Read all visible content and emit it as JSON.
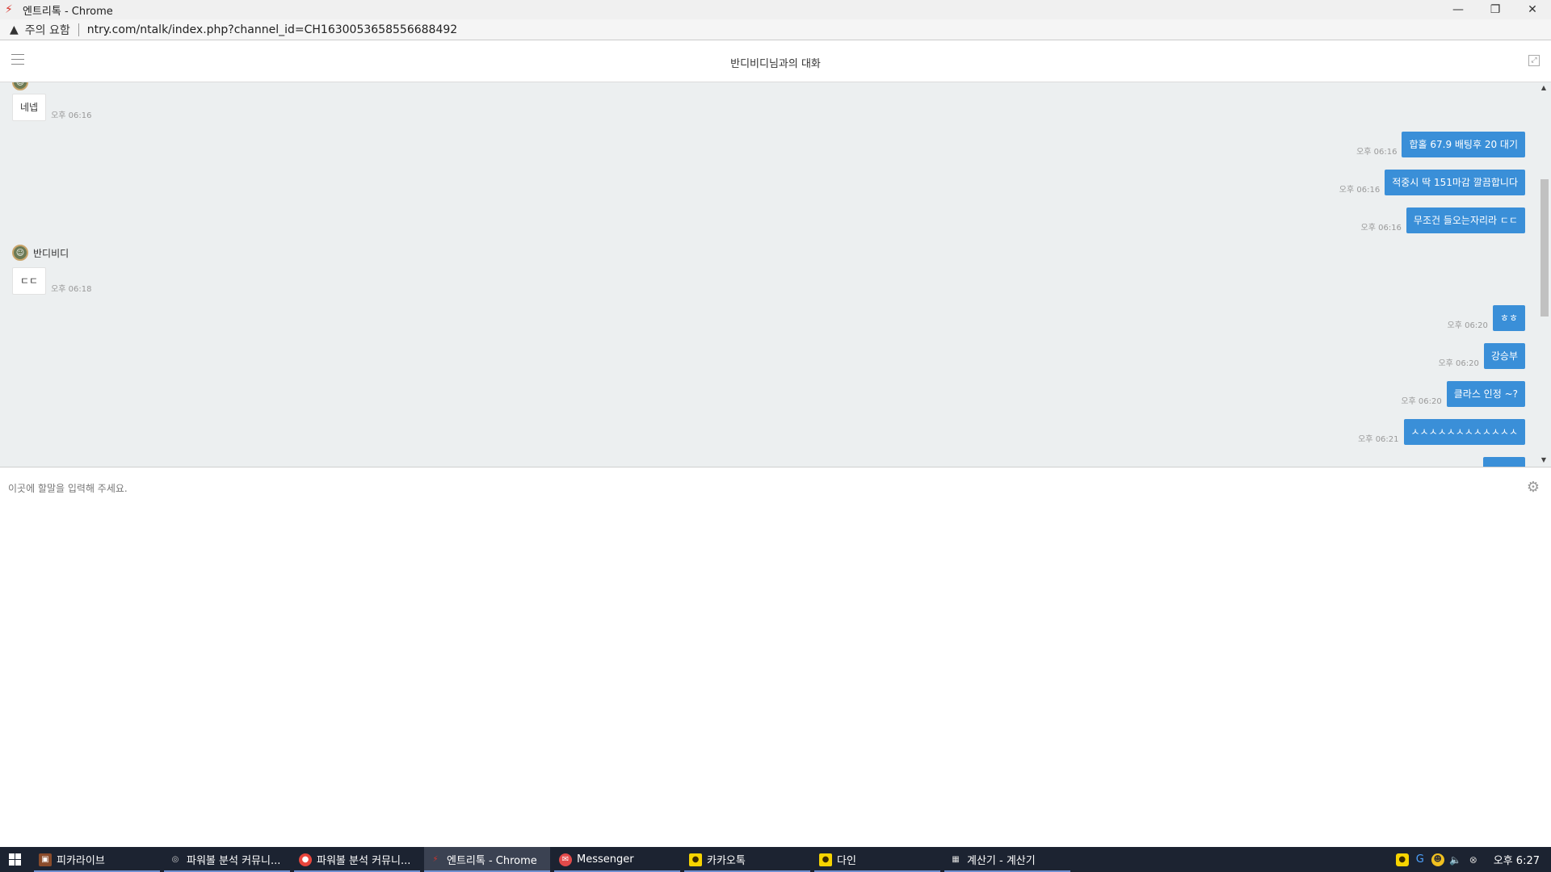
{
  "window": {
    "title": "엔트리톡 - Chrome",
    "minimize": "—",
    "restore": "❐",
    "close": "✕"
  },
  "address": {
    "warning": "주의 요함",
    "url": "ntry.com/ntalk/index.php?channel_id=CH1630053658556688492"
  },
  "chat": {
    "title": "반디비디님과의 대화",
    "input_placeholder": "이곳에 할말을 입력해 주세요.",
    "messages": [
      {
        "dir": "in",
        "text": "네넵",
        "time": "오후 06:16"
      },
      {
        "dir": "out",
        "text": "합홀 67.9 배팅후 20 대기",
        "time": "오후 06:16"
      },
      {
        "dir": "out",
        "text": "적중시 딱 151마감 깔끔합니다",
        "time": "오후 06:16"
      },
      {
        "dir": "out",
        "text": "무조건 들오는자리라 ㄷㄷ",
        "time": "오후 06:16"
      },
      {
        "dir": "in",
        "sender": "반디비디",
        "text": "ㄷㄷ",
        "time": "오후 06:18"
      },
      {
        "dir": "out",
        "text": "ㅎㅎ",
        "time": "오후 06:20"
      },
      {
        "dir": "out",
        "text": "강승부",
        "time": "오후 06:20"
      },
      {
        "dir": "out",
        "text": "클라스 인정 ~?",
        "time": "오후 06:20"
      },
      {
        "dir": "out",
        "text": "ㅅㅅㅅㅅㅅㅅㅅㅅㅅㅅㅅㅅ",
        "time": "오후 06:21"
      }
    ]
  },
  "taskbar": {
    "items": [
      {
        "label": "피카라이브"
      },
      {
        "label": "파워볼 분석 커뮤니..."
      },
      {
        "label": "파워볼 분석 커뮤니..."
      },
      {
        "label": "엔트리톡 - Chrome"
      },
      {
        "label": "Messenger"
      },
      {
        "label": "카카오톡"
      },
      {
        "label": "다인"
      },
      {
        "label": "계산기 - 계산기"
      }
    ],
    "clock": "오후 6:27"
  }
}
